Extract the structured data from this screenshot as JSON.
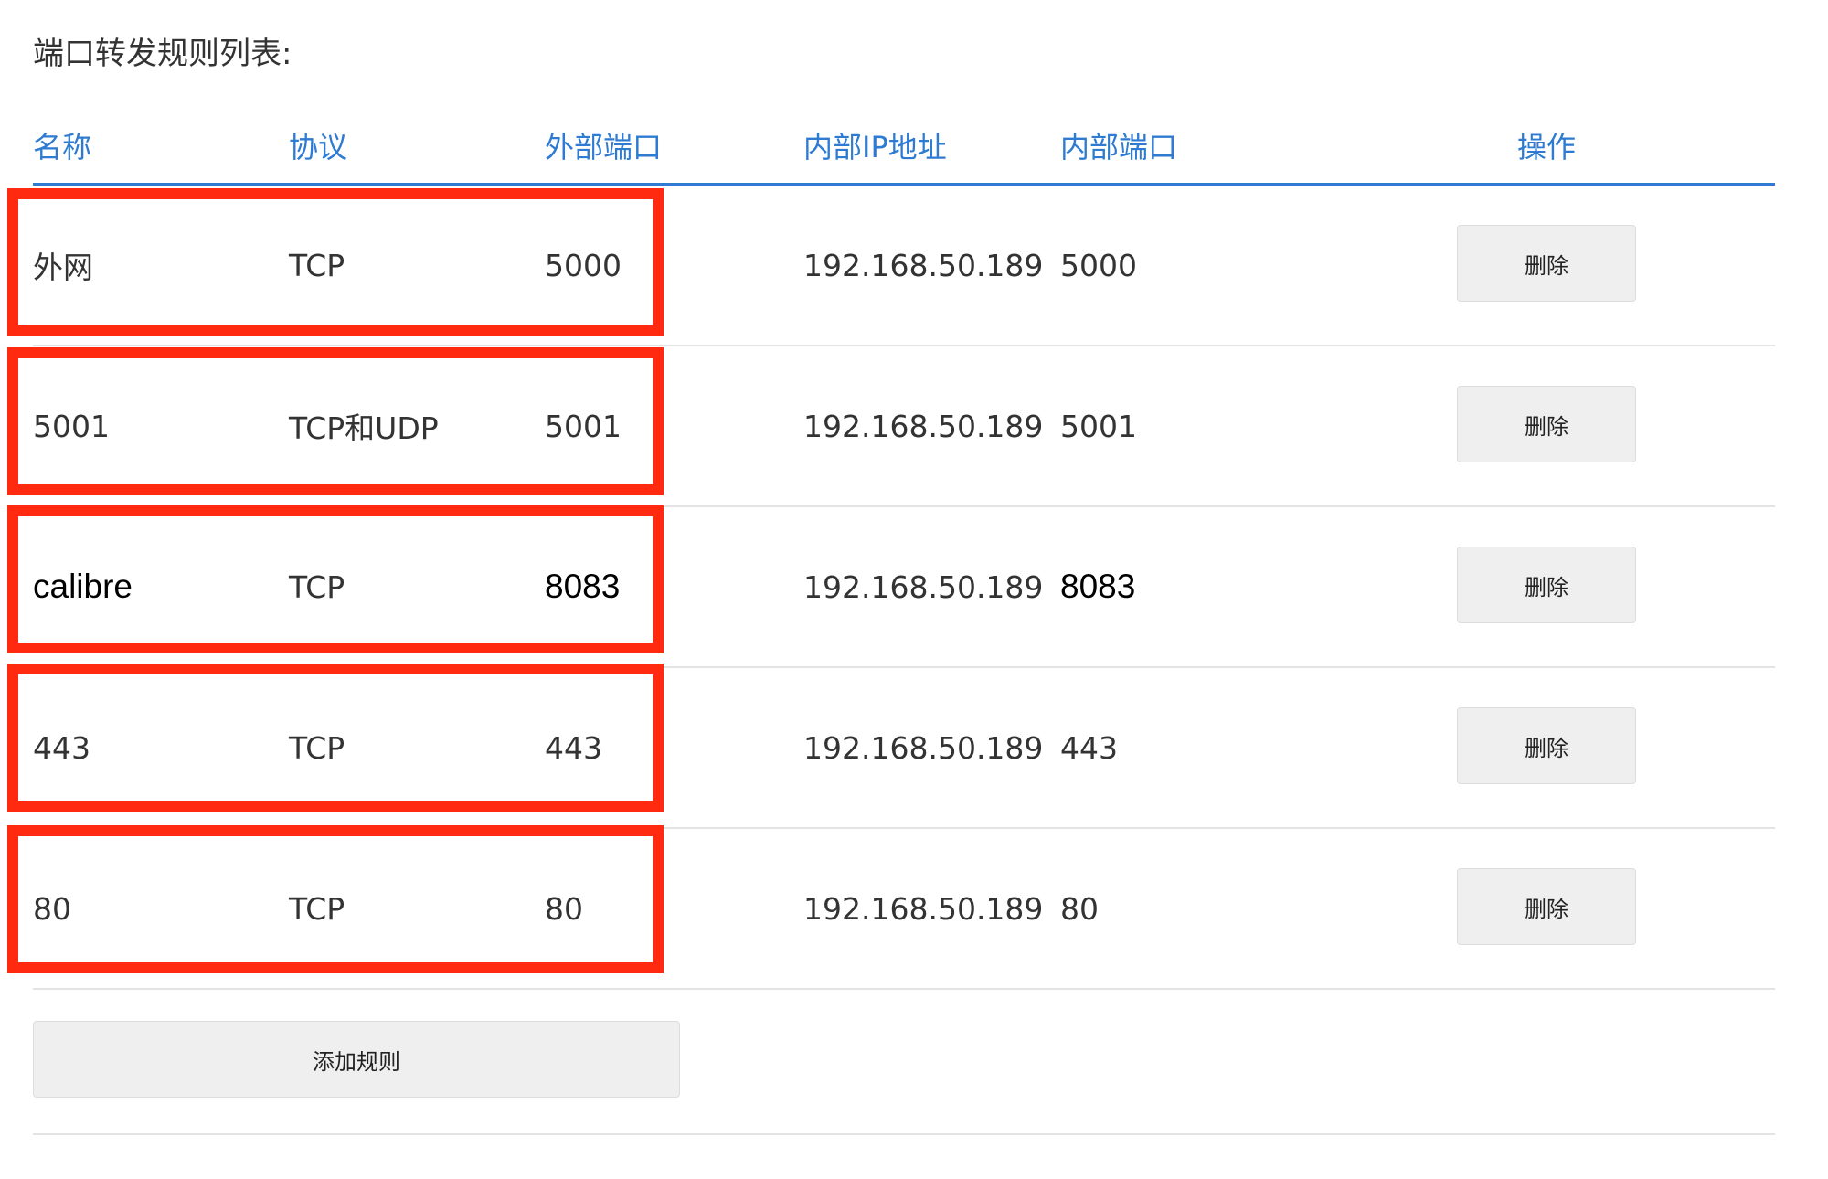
{
  "section": {
    "title": "端口转发规则列表:"
  },
  "table": {
    "headers": {
      "name": "名称",
      "protocol": "协议",
      "external_port": "外部端口",
      "internal_ip": "内部IP地址",
      "internal_port": "内部端口",
      "action": "操作"
    },
    "rows": [
      {
        "name": "外网",
        "protocol": "TCP",
        "external_port": "5000",
        "internal_ip": "192.168.50.189",
        "internal_port": "5000",
        "action": "删除"
      },
      {
        "name": "5001",
        "protocol": "TCP和UDP",
        "external_port": "5001",
        "internal_ip": "192.168.50.189",
        "internal_port": "5001",
        "action": "删除"
      },
      {
        "name": "calibre",
        "protocol": "TCP",
        "external_port": "8083",
        "internal_ip": "192.168.50.189",
        "internal_port": "8083",
        "action": "删除"
      },
      {
        "name": "443",
        "protocol": "TCP",
        "external_port": "443",
        "internal_ip": "192.168.50.189",
        "internal_port": "443",
        "action": "删除"
      },
      {
        "name": "80",
        "protocol": "TCP",
        "external_port": "80",
        "internal_ip": "192.168.50.189",
        "internal_port": "80",
        "action": "删除"
      }
    ]
  },
  "add_rule": {
    "label": "添加规则"
  },
  "colors": {
    "header_accent": "#2e7bd1",
    "highlight_border": "#ff2a10",
    "button_bg": "#efefef"
  }
}
